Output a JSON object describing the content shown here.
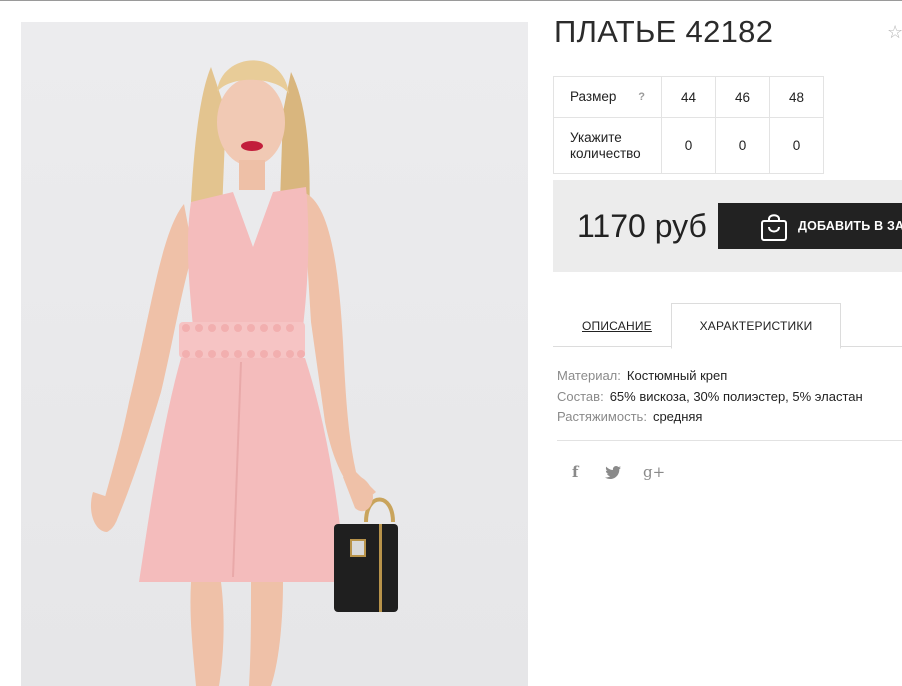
{
  "product": {
    "title": "ПЛАТЬЕ 42182",
    "favorite_icon": "star-outline-icon",
    "image_alt": "woman in pink dress with black handbag"
  },
  "sizes": {
    "size_label": "Размер",
    "help_mark": "?",
    "qty_label_line1": "Укажите",
    "qty_label_line2": "количество",
    "columns": [
      {
        "size": "44",
        "qty": "0"
      },
      {
        "size": "46",
        "qty": "0"
      },
      {
        "size": "48",
        "qty": "0"
      }
    ]
  },
  "buy": {
    "price": "1170 руб",
    "add_to_cart_label": "ДОБАВИТЬ В ЗАКАЗ",
    "cart_icon": "shopping-bag-icon"
  },
  "tabs": {
    "description": "ОПИСАНИЕ",
    "characteristics": "ХАРАКТЕРИСТИКИ",
    "active": "characteristics"
  },
  "specs": [
    {
      "key": "Материал:",
      "value": "Костюмный креп"
    },
    {
      "key": "Состав:",
      "value": "65% вискоза, 30% полиэстер, 5% эластан"
    },
    {
      "key": "Растяжимость:",
      "value": "средняя"
    }
  ],
  "social": {
    "facebook": "f",
    "twitter": "twitter-icon",
    "google_plus": "g+"
  },
  "colors": {
    "button_bg": "#222222",
    "buybox_bg": "#ececec",
    "dress_pink": "#f4bcbc"
  }
}
